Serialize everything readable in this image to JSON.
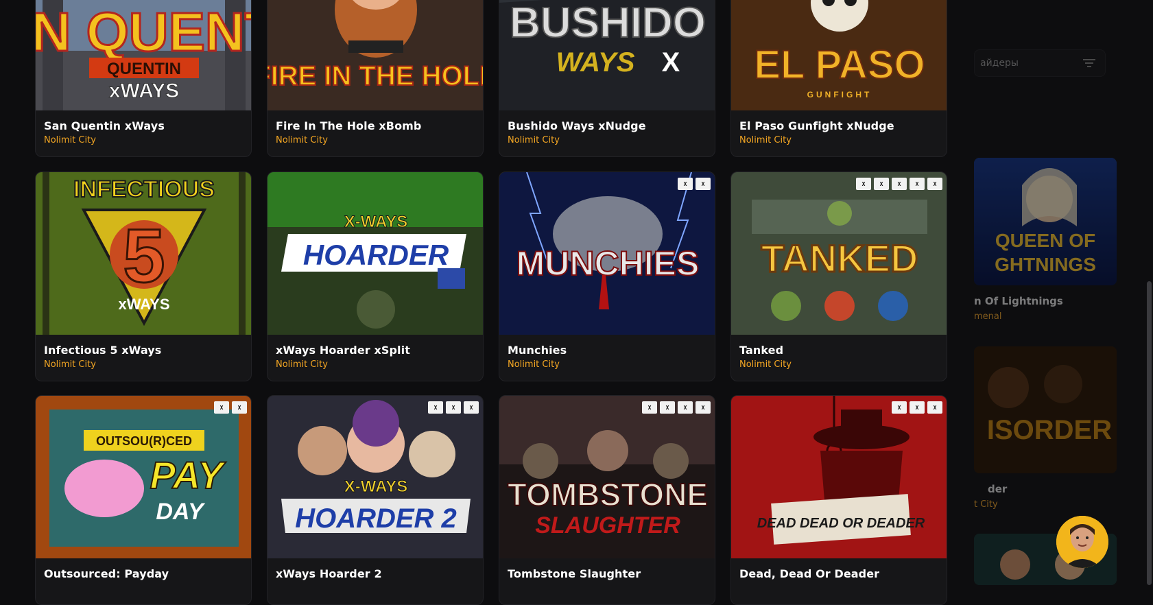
{
  "search": {
    "placeholder_fragment": "айдеры"
  },
  "background_cards": [
    {
      "title": "n Of Lightnings",
      "provider": "menal",
      "art_text": "QUEEN OF GHTNINGS"
    },
    {
      "title": "der",
      "provider": "t City",
      "art_text": "ISORDER"
    }
  ],
  "games": [
    {
      "title": "San Quentin xWays",
      "provider": "Nolimit City",
      "art_text": "SAN QUENTIN"
    },
    {
      "title": "Fire In The Hole xBomb",
      "provider": "Nolimit City",
      "art_text": "FIRE IN THE HOLE"
    },
    {
      "title": "Bushido Ways xNudge",
      "provider": "Nolimit City",
      "art_text": "BUSHIDO"
    },
    {
      "title": "El Paso Gunfight xNudge",
      "provider": "Nolimit City",
      "art_text": "EL PASO"
    },
    {
      "title": "Infectious 5 xWays",
      "provider": "Nolimit City",
      "art_text": "INFECTIOUS"
    },
    {
      "title": "xWays Hoarder xSplit",
      "provider": "Nolimit City",
      "art_text": "HOARDER"
    },
    {
      "title": "Munchies",
      "provider": "Nolimit City",
      "art_text": "MUNCHIES"
    },
    {
      "title": "Tanked",
      "provider": "Nolimit City",
      "art_text": "TANKED"
    },
    {
      "title": "Outsourced: Payday",
      "provider": "",
      "art_text": "PAY DAY"
    },
    {
      "title": "xWays Hoarder 2",
      "provider": "",
      "art_text": "HOARDER 2"
    },
    {
      "title": "Tombstone Slaughter",
      "provider": "",
      "art_text": "TOMBSTONE"
    },
    {
      "title": "Dead, Dead Or Deader",
      "provider": "",
      "art_text": "DEAD DEAD OR DEADER"
    }
  ],
  "colors": {
    "provider": "#f3a623",
    "card_bg": "#161618",
    "page_bg": "#0d0d0f"
  }
}
